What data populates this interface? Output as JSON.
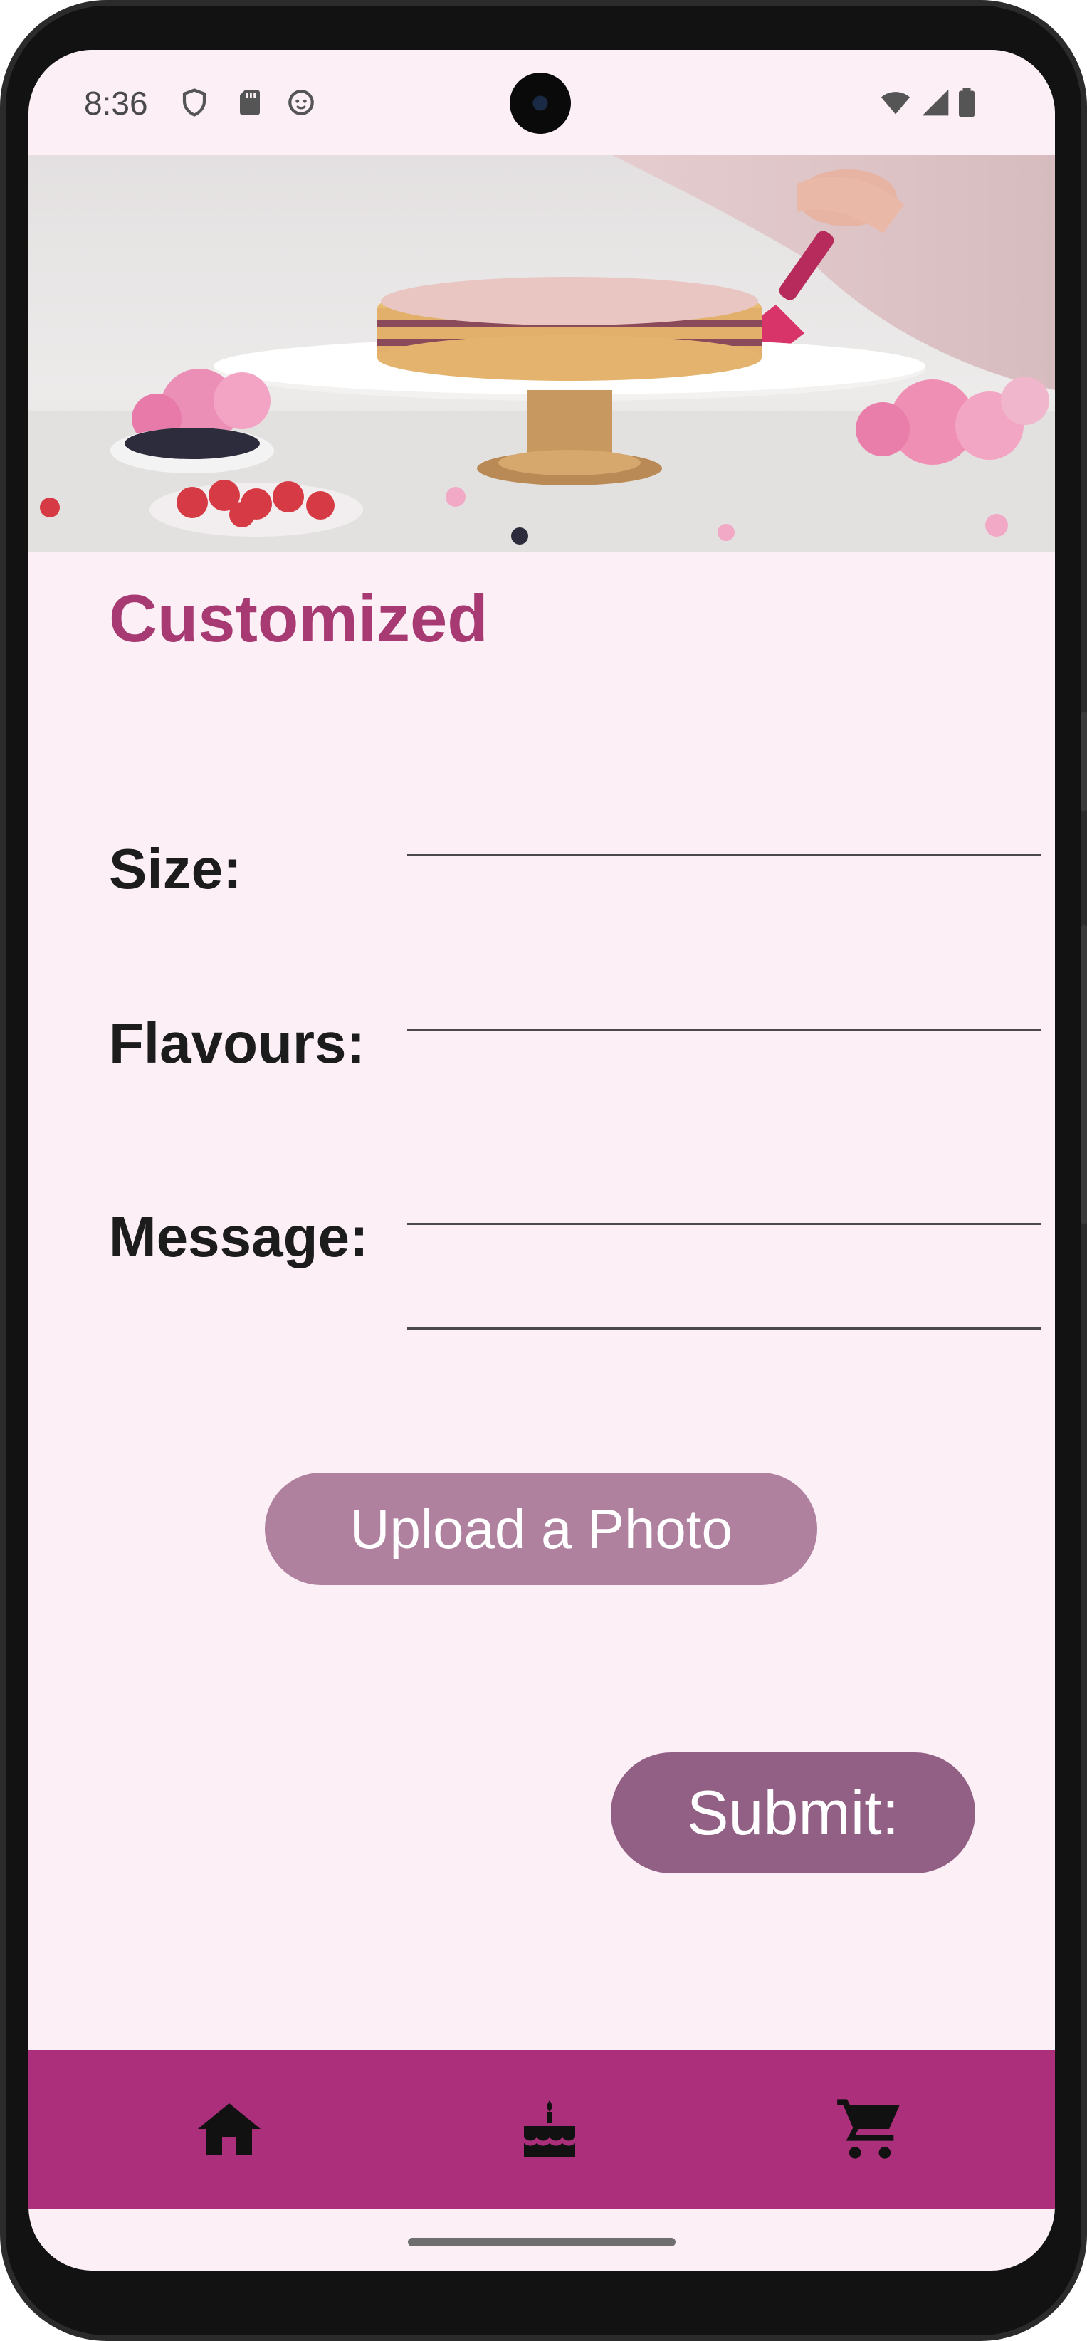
{
  "status_bar": {
    "time": "8:36",
    "left_icons": [
      "shield-icon",
      "sd-card-icon",
      "face-icon"
    ],
    "right_icons": [
      "wifi-icon",
      "cell-signal-icon",
      "battery-icon"
    ]
  },
  "hero": {
    "image_description": "cake being frosted on a stand with berries and flowers"
  },
  "page": {
    "title": "Customized"
  },
  "form": {
    "size_label": "Size:",
    "size_value": "",
    "flavours_label": "Flavours:",
    "flavours_value": "",
    "message_label": "Message:",
    "message_value": ""
  },
  "buttons": {
    "upload_label": "Upload a Photo",
    "submit_label": "Submit:"
  },
  "bottom_nav": {
    "items": [
      {
        "name": "home",
        "icon": "home-icon"
      },
      {
        "name": "cakes",
        "icon": "cake-icon"
      },
      {
        "name": "cart",
        "icon": "cart-icon"
      }
    ]
  },
  "colors": {
    "background": "#fcf0f6",
    "title": "#a83a73",
    "nav": "#ac2f7c",
    "upload_button": "#b0809f",
    "submit_button": "#925f85"
  }
}
